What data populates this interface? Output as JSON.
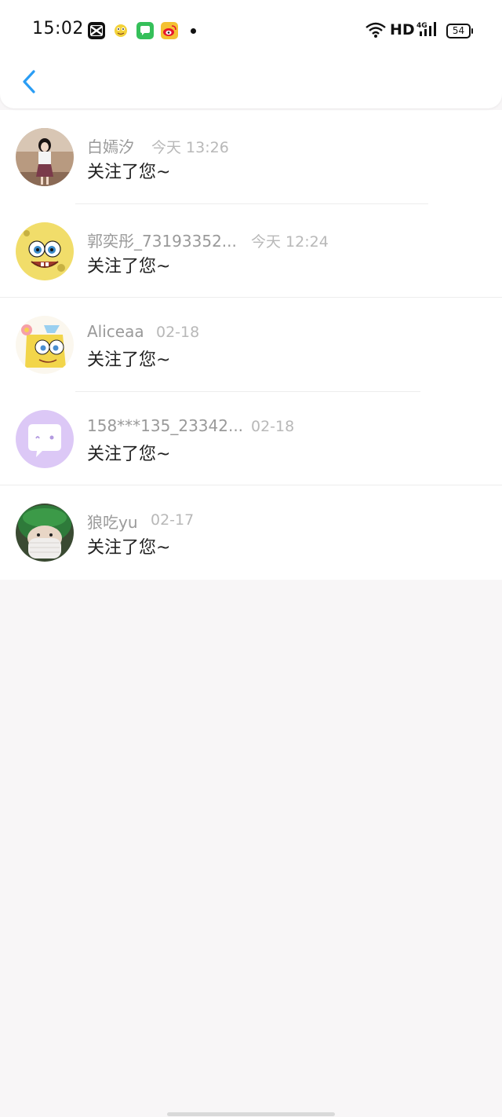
{
  "status_bar": {
    "time": "15:02",
    "network": "HD",
    "cell": "4G",
    "battery": "54",
    "notification_icons": [
      "capcut-icon",
      "cartoon-app-icon",
      "messages-icon",
      "weibo-icon"
    ]
  },
  "nav": {
    "back_icon": "chevron-left-icon",
    "accent": "#2a9df4"
  },
  "notifications": [
    {
      "name": "白嫣汐",
      "date": "今天 13:26",
      "message": "关注了您~",
      "avatar": "photo-girl"
    },
    {
      "name": "郭奕彤_73193352...",
      "date": "今天 12:24",
      "message": "关注了您~",
      "avatar": "spongebob"
    },
    {
      "name": "Aliceaa",
      "date": "02-18",
      "message": "关注了您~",
      "avatar": "spongebob-flower"
    },
    {
      "name": "158***135_23342...",
      "date": "02-18",
      "message": "关注了您~",
      "avatar": "chat-bubble-default"
    },
    {
      "name": "狼吃yu",
      "date": "02-17",
      "message": "关注了您~",
      "avatar": "photo-green-hat"
    }
  ]
}
